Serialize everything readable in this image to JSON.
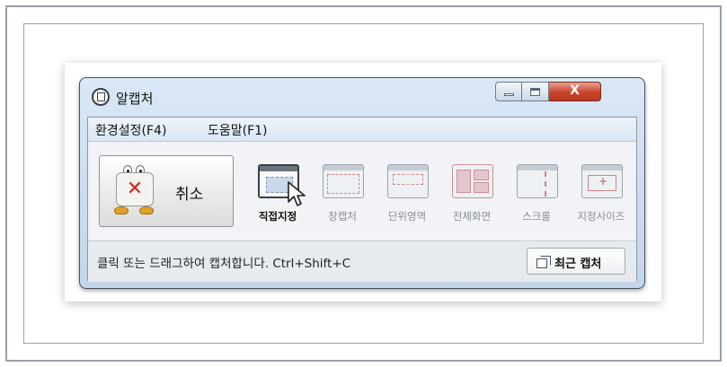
{
  "window": {
    "title": "알캡처",
    "close_glyph": "X"
  },
  "menu": {
    "items": [
      "환경설정(F4)",
      "도움말(F1)"
    ]
  },
  "cancel": {
    "label": "취소",
    "x_glyph": "✕"
  },
  "tools": [
    {
      "label": "직접지정",
      "icon": "direct-capture-icon",
      "active": true
    },
    {
      "label": "창캡처",
      "icon": "window-capture-icon",
      "active": false
    },
    {
      "label": "단위영역",
      "icon": "unit-region-icon",
      "active": false
    },
    {
      "label": "전체화면",
      "icon": "fullscreen-icon",
      "active": false
    },
    {
      "label": "스크롤",
      "icon": "scroll-capture-icon",
      "active": false
    },
    {
      "label": "지정사이즈",
      "icon": "fixed-size-icon",
      "active": false
    }
  ],
  "status": {
    "text": "클릭 또는 드래그하여 캡처합니다. Ctrl+Shift+C"
  },
  "recent": {
    "label": "최근 캡처",
    "icon": "recent-capture-icon"
  },
  "colors": {
    "accent_red": "#c8442b",
    "dash_red": "#d0828a"
  }
}
